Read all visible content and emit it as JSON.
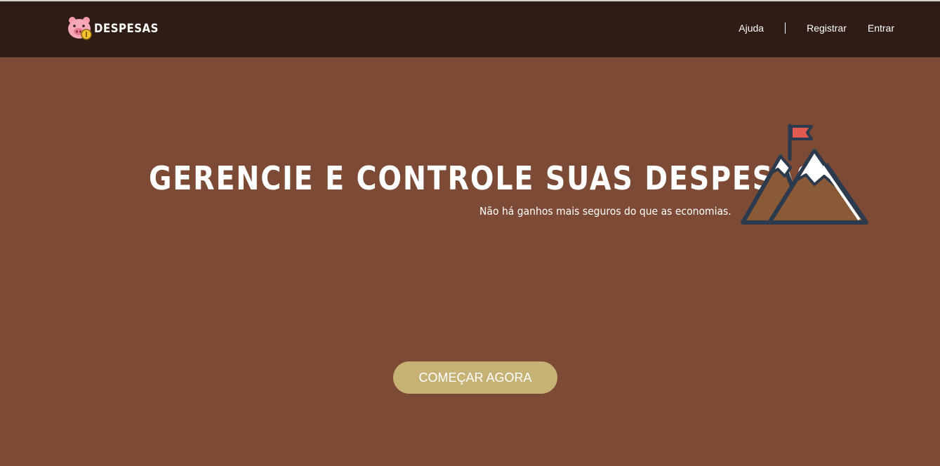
{
  "brand": {
    "name": "DESPESAS",
    "logo_icon": "piggy-coin-icon"
  },
  "nav": {
    "items": [
      {
        "label": "Ajuda"
      },
      {
        "label": "Registrar"
      },
      {
        "label": "Entrar"
      }
    ]
  },
  "hero": {
    "title": "GERENCIE E CONTROLE SUAS DESPESAS",
    "subtitle": "Não há ganhos mais seguros do que as economias.",
    "illustration_icon": "mountain-flag-icon",
    "cta_label": "COMEÇAR AGORA"
  },
  "colors": {
    "navbar_bg": "#2f1c15",
    "page_bg": "#7d4a35",
    "cta_bg": "#c7b276",
    "text": "#ffffff",
    "flag": "#e05a4f",
    "mountain_outline": "#2c3a4d"
  }
}
